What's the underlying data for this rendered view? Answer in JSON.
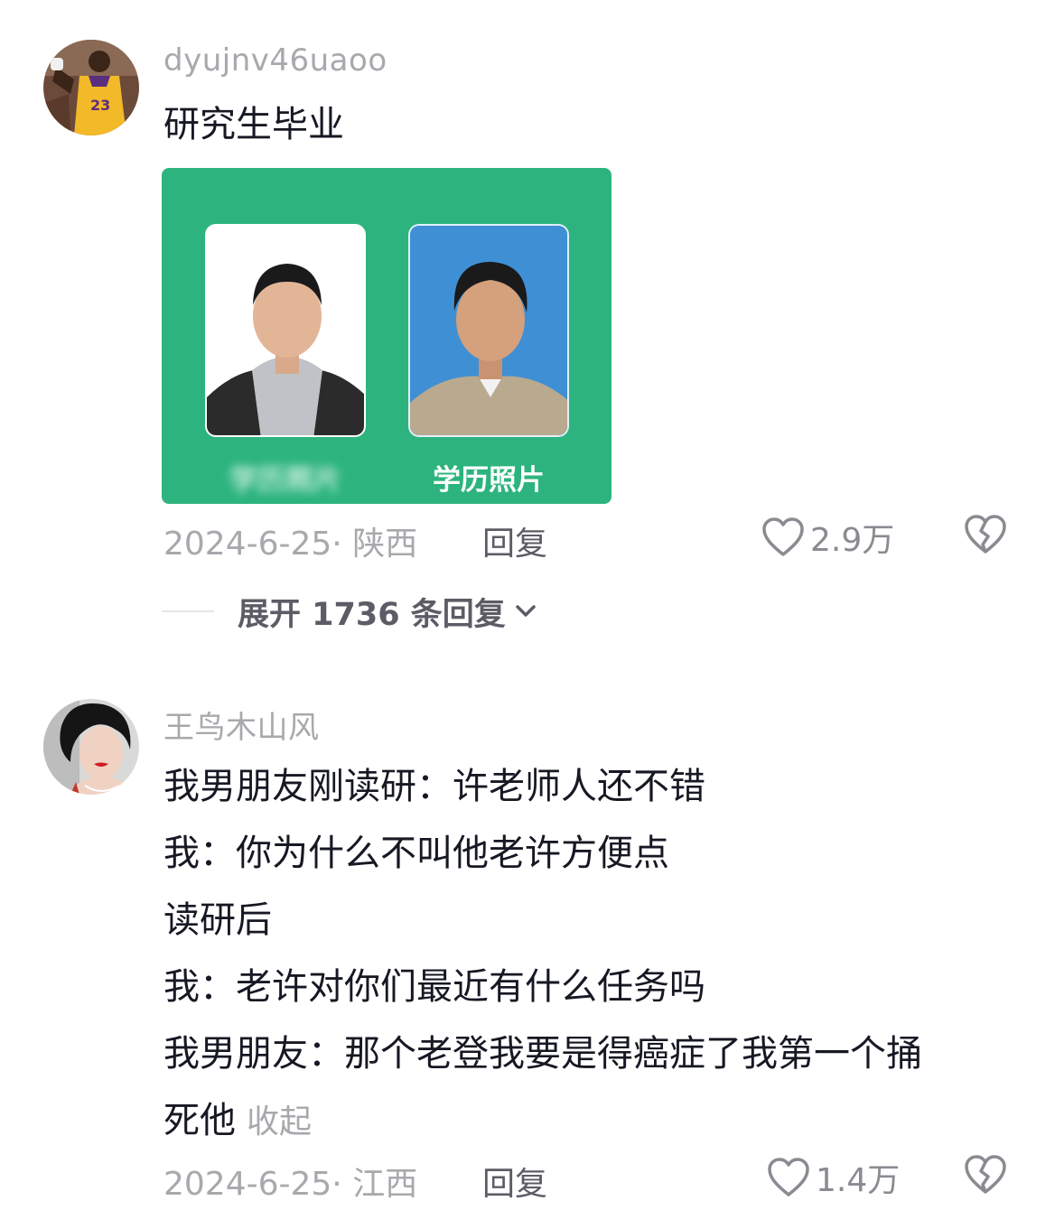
{
  "comments": [
    {
      "username": "dyujnv46uaoo",
      "text": "研究生毕业",
      "images": [
        {
          "caption": "学历照片"
        },
        {
          "caption": "学历照片"
        }
      ],
      "date_location": "2024-6-25· 陕西",
      "reply_label": "回复",
      "likes": "2.9万",
      "expand_replies": "展开 1736 条回复",
      "icons": {
        "like": "heart-outline-icon",
        "dislike": "broken-heart-icon",
        "expand": "chevron-down-icon"
      }
    },
    {
      "username": "王鸟木山风",
      "lines": [
        "我男朋友刚读研：许老师人还不错",
        "我：你为什么不叫他老许方便点",
        "读研后",
        "我：老许对你们最近有什么任务吗",
        "我男朋友：那个老登我要是得癌症了我第一个捅",
        "死他"
      ],
      "collapse_label": "收起",
      "date_location": "2024-6-25· 江西",
      "reply_label": "回复",
      "likes": "1.4万",
      "icons": {
        "like": "heart-outline-icon",
        "dislike": "broken-heart-icon"
      }
    }
  ],
  "colors": {
    "media_bg": "#2db47e",
    "muted": "#a8a8ad",
    "text": "#161823"
  }
}
